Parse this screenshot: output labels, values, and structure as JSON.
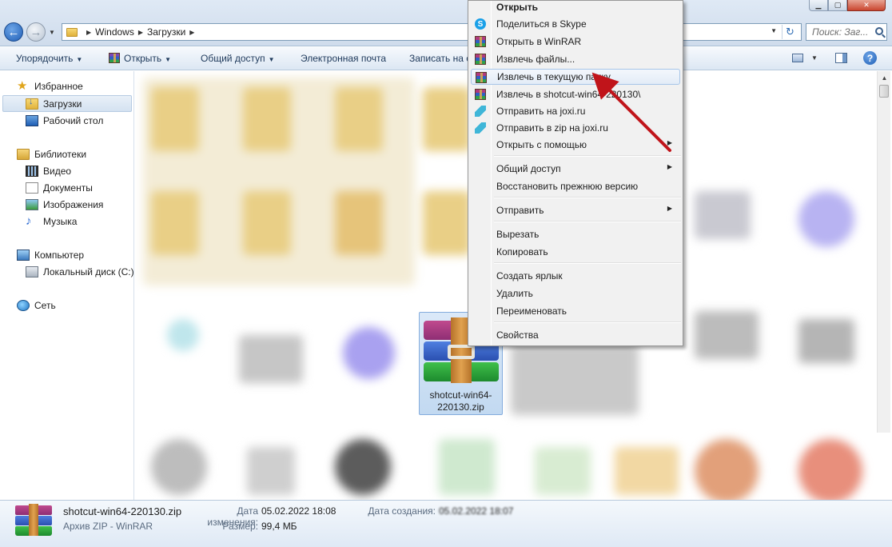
{
  "address": {
    "crumbs": [
      "Windows",
      "Загрузки"
    ],
    "search_placeholder": "Поиск: Заг..."
  },
  "toolbar": {
    "organize": "Упорядочить",
    "open": "Открыть",
    "share": "Общий доступ",
    "email": "Электронная почта",
    "burn": "Записать на с"
  },
  "nav": {
    "favorites": "Избранное",
    "downloads": "Загрузки",
    "desktop": "Рабочий стол",
    "libraries": "Библиотеки",
    "video": "Видео",
    "documents": "Документы",
    "images": "Изображения",
    "music": "Музыка",
    "computer": "Компьютер",
    "local_disk": "Локальный диск (C:)",
    "network": "Сеть"
  },
  "file": {
    "label": "shotcut-win64-220130.zip"
  },
  "context_menu": {
    "items": [
      {
        "label": "Открыть",
        "icon": "none"
      },
      {
        "label": "Поделиться в Skype",
        "icon": "skype-icon"
      },
      {
        "label": "Открыть в WinRAR",
        "icon": "winrar-icon"
      },
      {
        "label": "Извлечь файлы...",
        "icon": "winrar-icon"
      },
      {
        "label": "Извлечь в текущую папку",
        "icon": "winrar-icon"
      },
      {
        "label": "Извлечь в shotcut-win64-220130\\",
        "icon": "winrar-icon"
      },
      {
        "label": "Отправить на joxi.ru",
        "icon": "joxi-icon"
      },
      {
        "label": "Отправить в zip на joxi.ru",
        "icon": "joxi-icon"
      },
      {
        "label": "Открыть с помощью",
        "icon": "none"
      },
      {
        "label": "Общий доступ",
        "icon": "none"
      },
      {
        "label": "Восстановить прежнюю версию",
        "icon": "none"
      },
      {
        "label": "Отправить",
        "icon": "none"
      },
      {
        "label": "Вырезать",
        "icon": "none"
      },
      {
        "label": "Копировать",
        "icon": "none"
      },
      {
        "label": "Создать ярлык",
        "icon": "none"
      },
      {
        "label": "Удалить",
        "icon": "none"
      },
      {
        "label": "Переименовать",
        "icon": "none"
      },
      {
        "label": "Свойства",
        "icon": "none"
      }
    ],
    "highlighted": "Извлечь в текущую папку",
    "arrow_color": "#c0141a"
  },
  "details": {
    "name": "shotcut-win64-220130.zip",
    "type": "Архив ZIP - WinRAR",
    "modified_label": "Дата изменения:",
    "modified_value": "05.02.2022 18:08",
    "size_label": "Размер:",
    "size_value": "99,4 МБ",
    "created_label": "Дата создания:",
    "created_value": "05.02.2022 18:07"
  }
}
